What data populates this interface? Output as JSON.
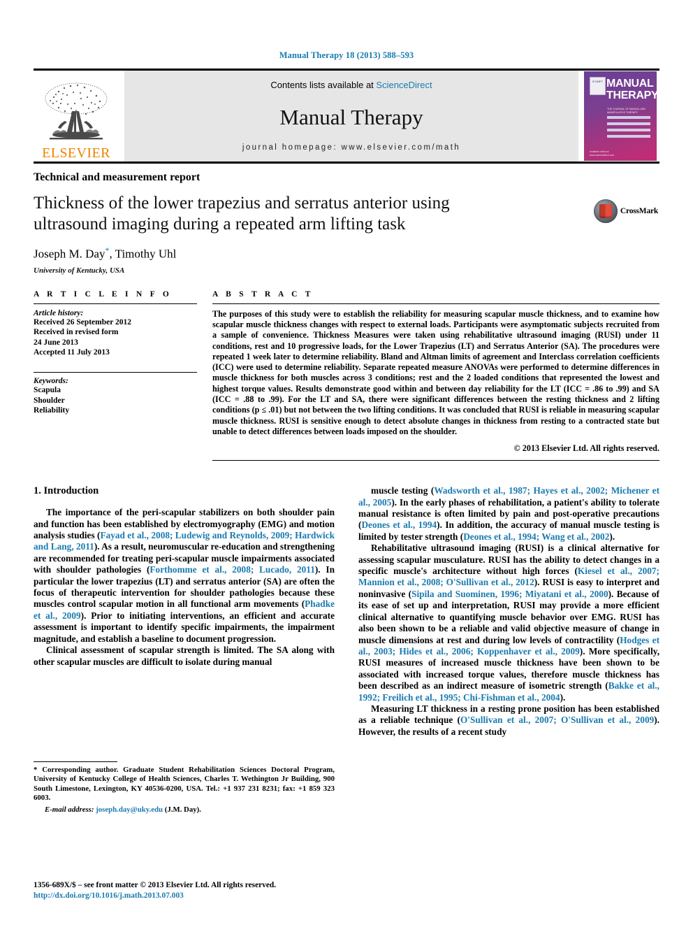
{
  "running_head": "Manual Therapy 18 (2013) 588–593",
  "masthead": {
    "publisher_name": "ELSEVIER",
    "contents_prefix": "Contents lists available at ",
    "contents_link": "ScienceDirect",
    "journal_name": "Manual Therapy",
    "homepage_line": "journal homepage: www.elsevier.com/math",
    "cover": {
      "title_line1": "MANUAL",
      "title_line2": "THERAPY",
      "badge_text": "IFOMPT",
      "subtitle": "THE JOURNAL OF MANUAL AND MANIPULATIVE THERAPY",
      "footer_text": "Available online at www.sciencedirect.com"
    }
  },
  "article": {
    "type_label": "Technical and measurement report",
    "title": "Thickness of the lower trapezius and serratus anterior using ultrasound imaging during a repeated arm lifting task",
    "authors": "Joseph M. Day",
    "authors_tail": ", Timothy Uhl",
    "corresponding_marker": "*",
    "affiliation": "University of Kentucky, USA",
    "crossmark_label": "CrossMark"
  },
  "info": {
    "heading": "A R T I C L E   I N F O",
    "history_heading": "Article history:",
    "history": [
      "Received 26 September 2012",
      "Received in revised form",
      "24 June 2013",
      "Accepted 11 July 2013"
    ],
    "keywords_heading": "Keywords:",
    "keywords": [
      "Scapula",
      "Shoulder",
      "Reliability"
    ]
  },
  "abstract": {
    "heading": "A B S T R A C T",
    "text": "The purposes of this study were to establish the reliability for measuring scapular muscle thickness, and to examine how scapular muscle thickness changes with respect to external loads. Participants were asymptomatic subjects recruited from a sample of convenience. Thickness Measures were taken using rehabilitative ultrasound imaging (RUSI) under 11 conditions, rest and 10 progressive loads, for the Lower Trapezius (LT) and Serratus Anterior (SA). The procedures were repeated 1 week later to determine reliability. Bland and Altman limits of agreement and Interclass correlation coefficients (ICC) were used to determine reliability. Separate repeated measure ANOVAs were performed to determine differences in muscle thickness for both muscles across 3 conditions; rest and the 2 loaded conditions that represented the lowest and highest torque values. Results demonstrate good within and between day reliability for the LT (ICC = .86 to .99) and SA (ICC = .88 to .99). For the LT and SA, there were significant differences between the resting thickness and 2 lifting conditions (p ≤ .01) but not between the two lifting conditions. It was concluded that RUSI is reliable in measuring scapular muscle thickness. RUSI is sensitive enough to detect absolute changes in thickness from resting to a contracted state but unable to detect differences between loads imposed on the shoulder.",
    "copyright": "© 2013 Elsevier Ltd. All rights reserved."
  },
  "introduction": {
    "heading": "1. Introduction",
    "left_paragraphs": [
      {
        "runs": [
          {
            "t": "The importance of the peri-scapular stabilizers on both shoulder pain and function has been established by electromyography (EMG) and motion analysis studies (",
            "c": false
          },
          {
            "t": "Fayad et al., 2008; Ludewig and Reynolds, 2009; Hardwick and Lang, 2011",
            "c": true
          },
          {
            "t": "). As a result, neuromuscular re-education and strengthening are recommended for treating peri-scapular muscle impairments associated with shoulder pathologies (",
            "c": false
          },
          {
            "t": "Forthomme et al., 2008; Lucado, 2011",
            "c": true
          },
          {
            "t": "). In particular the lower trapezius (LT) and serratus anterior (SA) are often the focus of therapeutic intervention for shoulder pathologies because these muscles control scapular motion in all functional arm movements (",
            "c": false
          },
          {
            "t": "Phadke et al., 2009",
            "c": true
          },
          {
            "t": "). Prior to initiating interventions, an efficient and accurate assessment is important to identify specific impairments, the impairment magnitude, and establish a baseline to document progression.",
            "c": false
          }
        ]
      },
      {
        "runs": [
          {
            "t": "Clinical assessment of scapular strength is limited. The SA along with other scapular muscles are difficult to isolate during manual",
            "c": false
          }
        ]
      }
    ],
    "right_paragraphs": [
      {
        "runs": [
          {
            "t": "muscle testing (",
            "c": false
          },
          {
            "t": "Wadsworth et al., 1987; Hayes et al., 2002; Michener et al., 2005",
            "c": true
          },
          {
            "t": "). In the early phases of rehabilitation, a patient's ability to tolerate manual resistance is often limited by pain and post-operative precautions (",
            "c": false
          },
          {
            "t": "Deones et al., 1994",
            "c": true
          },
          {
            "t": "). In addition, the accuracy of manual muscle testing is limited by tester strength (",
            "c": false
          },
          {
            "t": "Deones et al., 1994; Wang et al., 2002",
            "c": true
          },
          {
            "t": ").",
            "c": false
          }
        ]
      },
      {
        "runs": [
          {
            "t": "Rehabilitative ultrasound imaging (RUSI) is a clinical alternative for assessing scapular musculature. RUSI has the ability to detect changes in a specific muscle's architecture without high forces (",
            "c": false
          },
          {
            "t": "Kiesel et al., 2007; Mannion et al., 2008; O'Sullivan et al., 2012",
            "c": true
          },
          {
            "t": "). RUSI is easy to interpret and noninvasive (",
            "c": false
          },
          {
            "t": "Sipila and Suominen, 1996; Miyatani et al., 2000",
            "c": true
          },
          {
            "t": "). Because of its ease of set up and interpretation, RUSI may provide a more efficient clinical alternative to quantifying muscle behavior over EMG. RUSI has also been shown to be a reliable and valid objective measure of change in muscle dimensions at rest and during low levels of contractility (",
            "c": false
          },
          {
            "t": "Hodges et al., 2003; Hides et al., 2006; Koppenhaver et al., 2009",
            "c": true
          },
          {
            "t": "). More specifically, RUSI measures of increased muscle thickness have been shown to be associated with increased torque values, therefore muscle thickness has been described as an indirect measure of isometric strength (",
            "c": false
          },
          {
            "t": "Bakke et al., 1992; Freilich et al., 1995; Chi-Fishman et al., 2004",
            "c": true
          },
          {
            "t": ").",
            "c": false
          }
        ]
      },
      {
        "runs": [
          {
            "t": "Measuring LT thickness in a resting prone position has been established as a reliable technique (",
            "c": false
          },
          {
            "t": "O'Sullivan et al., 2007; O'Sullivan et al., 2009",
            "c": true
          },
          {
            "t": "). However, the results of a recent study",
            "c": false
          }
        ]
      }
    ]
  },
  "footnote": {
    "text": "* Corresponding author. Graduate Student Rehabilitation Sciences Doctoral Program, University of Kentucky College of Health Sciences, Charles T. Wethington Jr Building, 900 South Limestone, Lexington, KY 40536-0200, USA. Tel.: +1 937 231 8231; fax: +1 859 323 6003.",
    "email_label": "E-mail address:",
    "email": "joseph.day@uky.edu",
    "email_attrib": "(J.M. Day)."
  },
  "page_footer": {
    "issn_line": "1356-689X/$ – see front matter © 2013 Elsevier Ltd. All rights reserved.",
    "doi": "http://dx.doi.org/10.1016/j.math.2013.07.003"
  },
  "colors": {
    "link": "#1a7bb0",
    "elsevier_orange": "#ef8200"
  }
}
